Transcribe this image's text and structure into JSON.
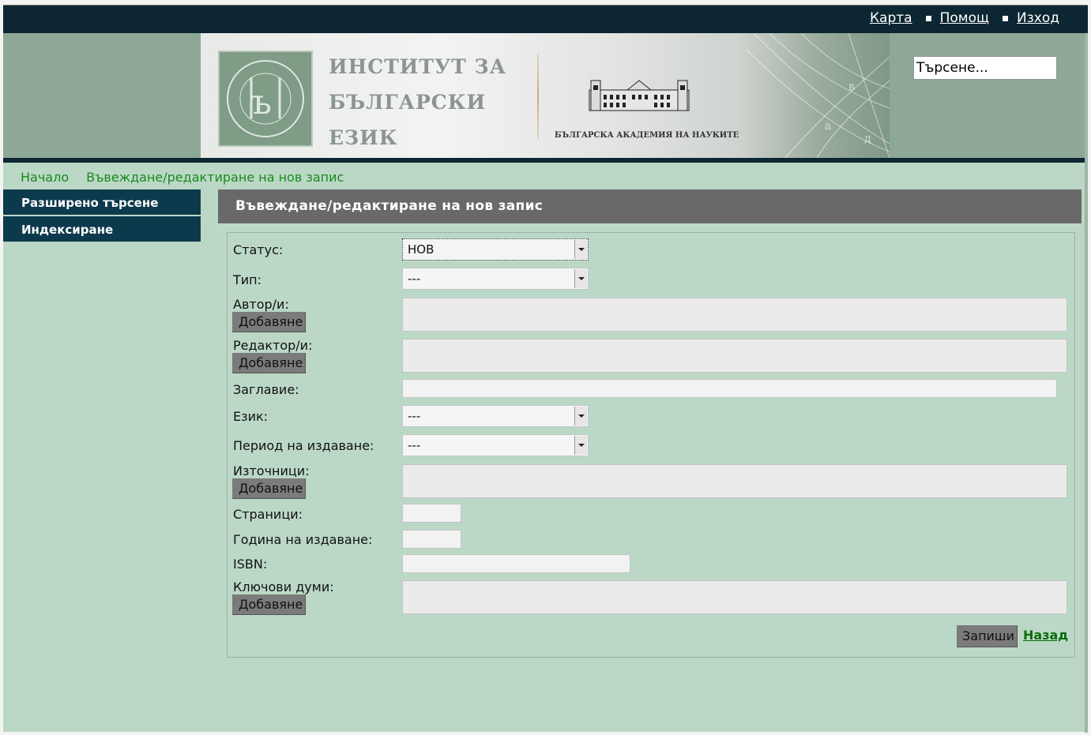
{
  "topnav": {
    "links": [
      "Карта",
      "Помощ",
      "Изход"
    ]
  },
  "header": {
    "institute_lines": [
      "ИНСТИТУТ ЗА",
      "БЪЛГАРСКИ",
      "ЕЗИК"
    ],
    "logo_ring_text": "ИНСТИТУТ ЗА БЪЛГАРСКИ ЕЗИК",
    "academy_text": "БЪЛГАРСКА АКАДЕМИЯ НА НАУКИТЕ",
    "search_value": "Търсене..."
  },
  "breadcrumb": {
    "home": "Начало",
    "current": "Въвеждане/редактиране на нов запис"
  },
  "sidebar": {
    "items": [
      "Разширено търсене",
      "Индексиране"
    ]
  },
  "main": {
    "title": "Въвеждане/редактиране на нов запис"
  },
  "form": {
    "status_label": "Статус:",
    "status_value": "НОВ",
    "type_label": "Тип:",
    "type_value": "---",
    "authors_label": "Автор/и:",
    "editors_label": "Редактор/и:",
    "title_label": "Заглавие:",
    "language_label": "Език:",
    "language_value": "---",
    "period_label": "Период на издаване:",
    "period_value": "---",
    "sources_label": "Източници:",
    "pages_label": "Страници:",
    "year_label": "Година на издаване:",
    "isbn_label": "ISBN:",
    "keywords_label": "Ключови думи:",
    "add_label": "Добавяне",
    "save_label": "Запиши",
    "back_label": "Назад"
  },
  "colors": {
    "topbar": "#0c2733",
    "page_bg": "#bbd8c7",
    "sidebar_bg": "#0c3a4c",
    "title_bar": "#696969",
    "link_green": "#1a8a1a"
  }
}
